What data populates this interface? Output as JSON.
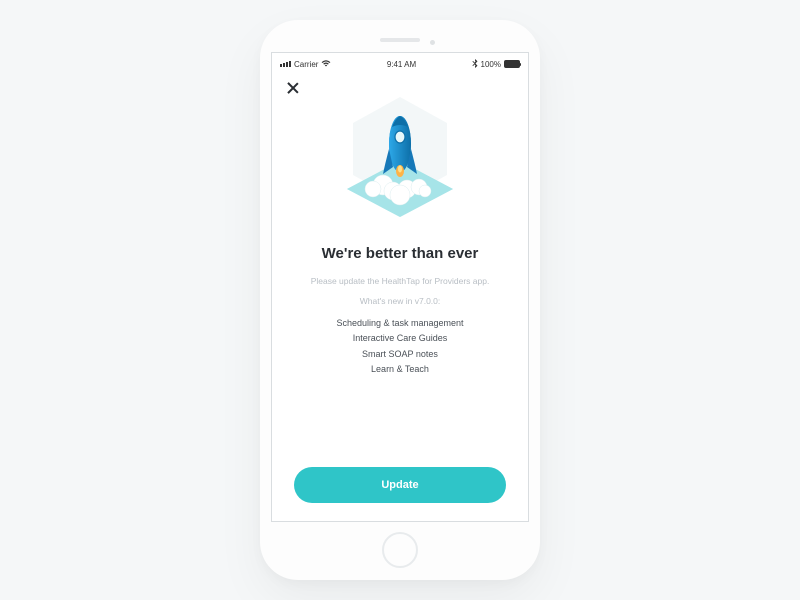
{
  "statusBar": {
    "carrier": "Carrier",
    "time": "9:41 AM",
    "battery": "100%"
  },
  "modal": {
    "title": "We're better than ever",
    "subtitle": "Please update the HealthTap for Providers app.",
    "whatsNew": "What's new in v7.0.0:",
    "features": [
      "Scheduling & task management",
      "Interactive Care Guides",
      "Smart SOAP notes",
      "Learn & Teach"
    ],
    "buttonLabel": "Update"
  },
  "colors": {
    "accent": "#2fc5c8",
    "illustrationBlue": "#1b8fd6",
    "illustrationLight": "#cdeef2"
  }
}
